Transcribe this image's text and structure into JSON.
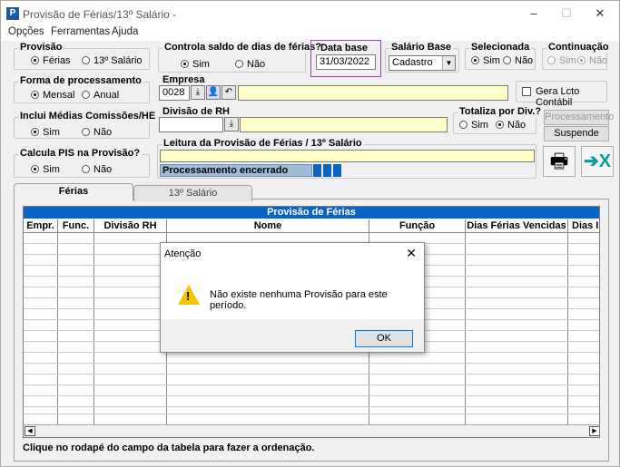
{
  "window": {
    "title": "Provisão de Férias/13º Salário -",
    "icon": "P",
    "min": "–",
    "max": "☐",
    "close": "✕"
  },
  "menu": [
    "Opções",
    "Ferramentas",
    "Ajuda"
  ],
  "provisao": {
    "title": "Provisão",
    "opt1": "Férias",
    "opt2": "13º Salário"
  },
  "controla": {
    "title": "Controla saldo de dias de férias?",
    "sim": "Sim",
    "nao": "Não"
  },
  "data_base": {
    "title": "Data base",
    "value": "31/03/2022"
  },
  "salario_base": {
    "title": "Salário Base",
    "value": "Cadastro"
  },
  "selecionada": {
    "title": "Selecionada",
    "sim": "Sim",
    "nao": "Não"
  },
  "continuacao": {
    "title": "Continuação",
    "sim": "Sim",
    "nao": "Não"
  },
  "forma": {
    "title": "Forma de processamento",
    "mensal": "Mensal",
    "anual": "Anual"
  },
  "empresa": {
    "title": "Empresa",
    "code": "0028"
  },
  "gera": {
    "label": "Gera Lcto Contábil"
  },
  "inclui": {
    "title": "Inclui Médias Comissões/HE",
    "sim": "Sim",
    "nao": "Não"
  },
  "divisao": {
    "title": "Divisão de RH"
  },
  "totaliza": {
    "title": "Totaliza por Div.?",
    "sim": "Sim",
    "nao": "Não"
  },
  "buttons": {
    "processamento": "Processamento",
    "suspende": "Suspende"
  },
  "calcula": {
    "title": "Calcula PIS na Provisão?",
    "sim": "Sim",
    "nao": "Não"
  },
  "leitura": {
    "title": "Leitura da Provisão de Férias / 13º Salário",
    "status": "Processamento encerrado"
  },
  "tabs": [
    "Férias",
    "13º Salário"
  ],
  "grid": {
    "header": "Provisão de Férias",
    "columns": [
      "Empr.",
      "Func.",
      "Divisão RH",
      "Nome",
      "Função",
      "Dias Férias Vencidas",
      "Dias I"
    ]
  },
  "footer": "Clique no rodapé do campo da tabela  para fazer a ordenação.",
  "dialog": {
    "title": "Atenção",
    "message": "Não existe nenhuma Provisão para este período.",
    "ok": "OK"
  }
}
